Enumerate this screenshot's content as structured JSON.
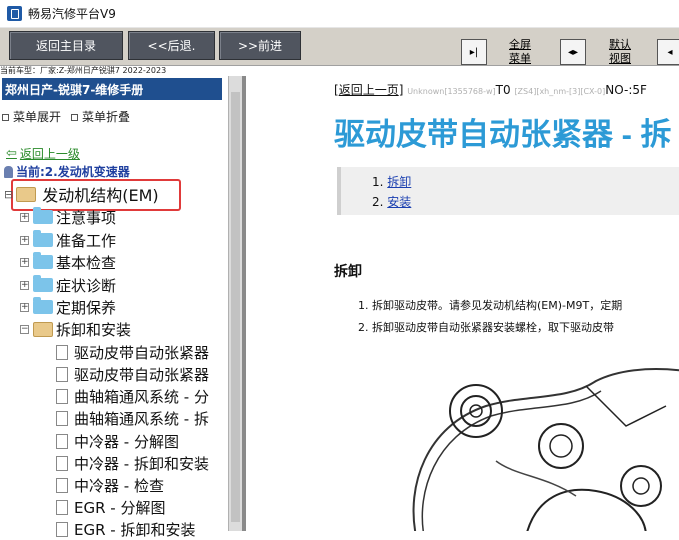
{
  "window": {
    "title": "畅易汽修平台V9"
  },
  "toolbar": {
    "home": "返回主目录",
    "back": "<<后退.",
    "forward": ">>前进",
    "fullscreen_line1": "全屏",
    "fullscreen_line2": "菜单",
    "default_line1": "默认",
    "default_line2": "视图"
  },
  "caption": "当前车型：厂家:Z-郑州日产锐骐7 2022-2023",
  "left": {
    "car_header": "郑州日产-锐骐7-维修手册",
    "expand_menu": "菜单展开",
    "collapse_menu": "菜单折叠",
    "back_up": "返回上一级",
    "current": "当前:2.发动机变速器",
    "root": "发动机结构(EM)",
    "folders": [
      "注意事项",
      "准备工作",
      "基本检查",
      "症状诊断",
      "定期保养",
      "拆卸和安装"
    ],
    "docs": [
      "驱动皮带自动张紧器",
      "驱动皮带自动张紧器",
      "曲轴箱通风系统 - 分",
      "曲轴箱通风系统 - 拆",
      "中冷器 - 分解图",
      "中冷器 - 拆卸和安装",
      "中冷器 - 检查",
      "EGR - 分解图",
      "EGR - 拆卸和安装"
    ]
  },
  "content": {
    "back_link": "返回上一页",
    "meta_faint1": "Unknown[1355768-w]",
    "meta_code": "T0",
    "meta_faint2": "[ZS4][xh_nm-[3][CX-0]",
    "meta_tail": "NO-:5F",
    "title": "驱动皮带自动张紧器 - 拆",
    "toc": [
      "拆卸",
      "安装"
    ],
    "section": "拆卸",
    "steps": [
      "1. 拆卸驱动皮带。请参见发动机结构(EM)-M9T，定期",
      "2. 拆卸驱动皮带自动张紧器安装螺栓，取下驱动皮带"
    ]
  },
  "colors": {
    "accent": "#2c9ad6",
    "header_bg": "#1f4f8f",
    "highlight": "#e03a3a"
  }
}
